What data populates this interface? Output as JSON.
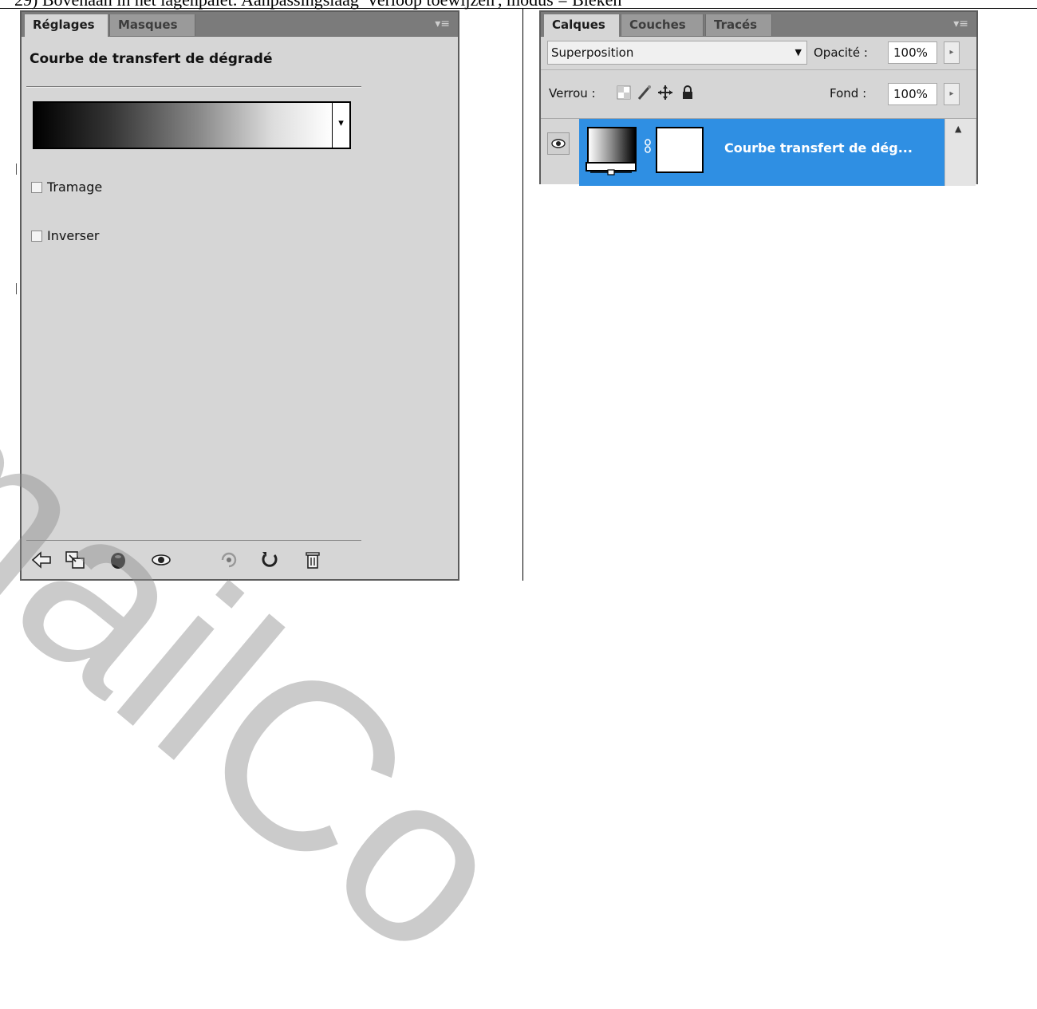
{
  "caption": "29) Bovenaan in het lagenpalet: Aanpassingslaag 'Verloop toewijzen', modus = Bleken",
  "adjustments_panel": {
    "tabs": [
      {
        "label": "Réglages",
        "active": true
      },
      {
        "label": "Masques",
        "active": false
      }
    ],
    "menu_icon": "panel-menu-icon",
    "title": "Courbe de transfert de dégradé",
    "gradient": {
      "from": "#000000",
      "to": "#ffffff"
    },
    "dither_label": "Tramage",
    "dither_checked": false,
    "reverse_label": "Inverser",
    "reverse_checked": false,
    "footer_icons": [
      "back-arrow-icon",
      "clip-to-layer-icon",
      "visibility-toggle-icon",
      "view-previous-state-icon",
      "reset-icon",
      "reset-to-default-icon",
      "trash-icon"
    ]
  },
  "layers_panel": {
    "tabs": [
      {
        "label": "Calques",
        "active": true
      },
      {
        "label": "Couches",
        "active": false
      },
      {
        "label": "Tracés",
        "active": false
      }
    ],
    "blend_mode": "Superposition",
    "opacity_label": "Opacité :",
    "opacity_value": "100%",
    "lock_label": "Verrou :",
    "fill_label": "Fond :",
    "fill_value": "100%",
    "layer": {
      "name": "Courbe transfert de dég...",
      "selected": true,
      "selection_color": "#2f8fe3"
    }
  },
  "watermark": "mailCo"
}
